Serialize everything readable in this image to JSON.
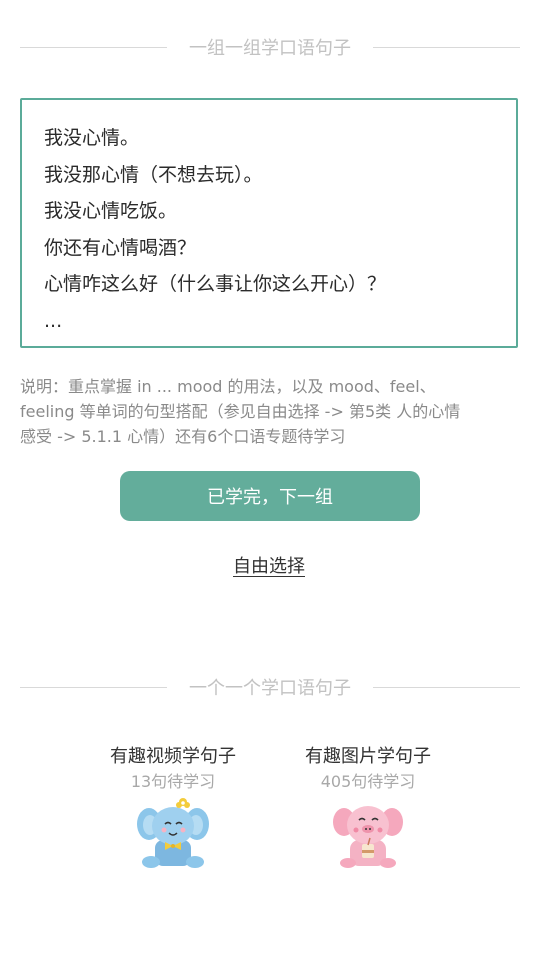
{
  "group_section": {
    "title": "一组一组学口语句子",
    "sentences": [
      "我没心情。",
      "我没那心情（不想去玩）。",
      "我没心情吃饭。",
      "你还有心情喝酒？",
      "心情咋这么好（什么事让你这么开心）？",
      "..."
    ],
    "explanation_lines": [
      "说明：重点掌握 in ... mood 的用法，以及 mood、feel、",
      "feeling 等单词的句型搭配（参见自由选择 -> 第5类 人的心情",
      "感受 -> 5.1.1 心情）还有6个口语专题待学习"
    ],
    "next_button_label": "已学完，下一组",
    "free_choice_label": "自由选择"
  },
  "single_section": {
    "title": "一个一个学口语句子",
    "cards": [
      {
        "title": "有趣视频学句子",
        "subtitle": "13句待学习",
        "icon": "blue-elephant-mascot-icon"
      },
      {
        "title": "有趣图片学句子",
        "subtitle": "405句待学习",
        "icon": "pink-pig-mascot-icon"
      }
    ]
  },
  "colors": {
    "accent": "#63ad9b",
    "box_border": "#5bab99",
    "muted_text": "#8a8a8a",
    "divider": "#d9d9d9"
  }
}
